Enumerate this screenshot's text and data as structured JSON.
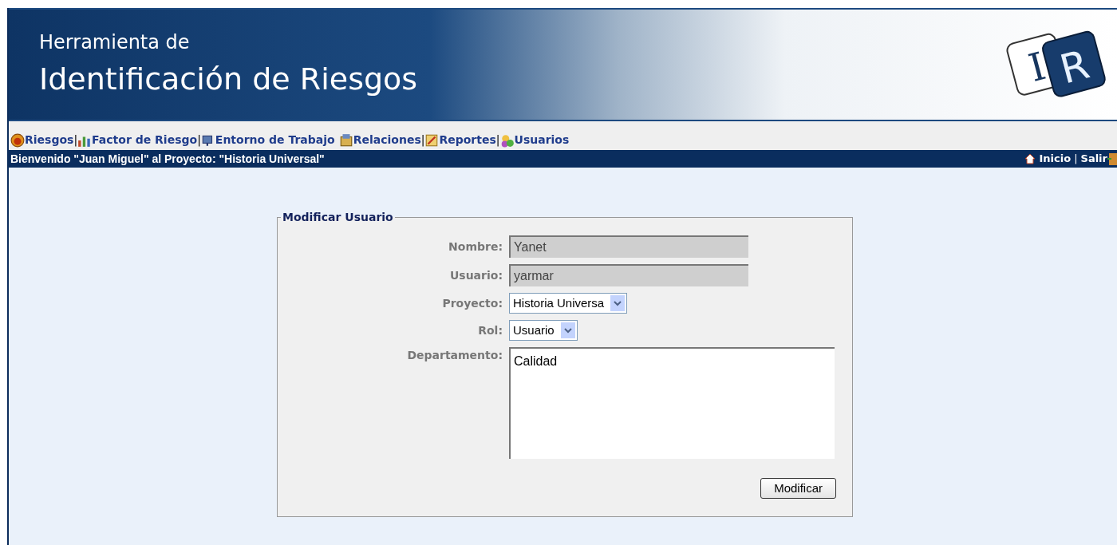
{
  "header": {
    "title_line_1": "Herramienta de",
    "title_line_2": "Identificación de Riesgos",
    "logo_letters": [
      "I",
      "R"
    ]
  },
  "nav": [
    {
      "label": "Riesgos",
      "separator": "|"
    },
    {
      "label": "Factor de Riesgo",
      "separator": "|"
    },
    {
      "label": "Entorno de Trabajo"
    },
    {
      "label": "Relaciones",
      "separator": "|"
    },
    {
      "label": "Reportes",
      "separator": "|"
    },
    {
      "label": "Usuarios"
    }
  ],
  "welcome_bar": {
    "message": "Bienvenido \"Juan Miguel\" al Proyecto: \"Historia Universal\"",
    "links": [
      {
        "label": "Inicio",
        "separator": "|"
      },
      {
        "label": "Salir"
      }
    ]
  },
  "form": {
    "legend": "Modificar Usuario",
    "fields": [
      {
        "kind": "text",
        "label": "Nombre:",
        "value": "Yanet",
        "disabled": true
      },
      {
        "kind": "text",
        "label": "Usuario:",
        "value": "yarmar",
        "disabled": true
      },
      {
        "kind": "select",
        "label": "Proyecto:",
        "value": "Historia Universa"
      },
      {
        "kind": "select",
        "label": "Rol:",
        "value": "Usuario"
      },
      {
        "kind": "textarea",
        "label": "Departamento:",
        "value": "Calidad"
      }
    ],
    "submit": "Modificar"
  }
}
